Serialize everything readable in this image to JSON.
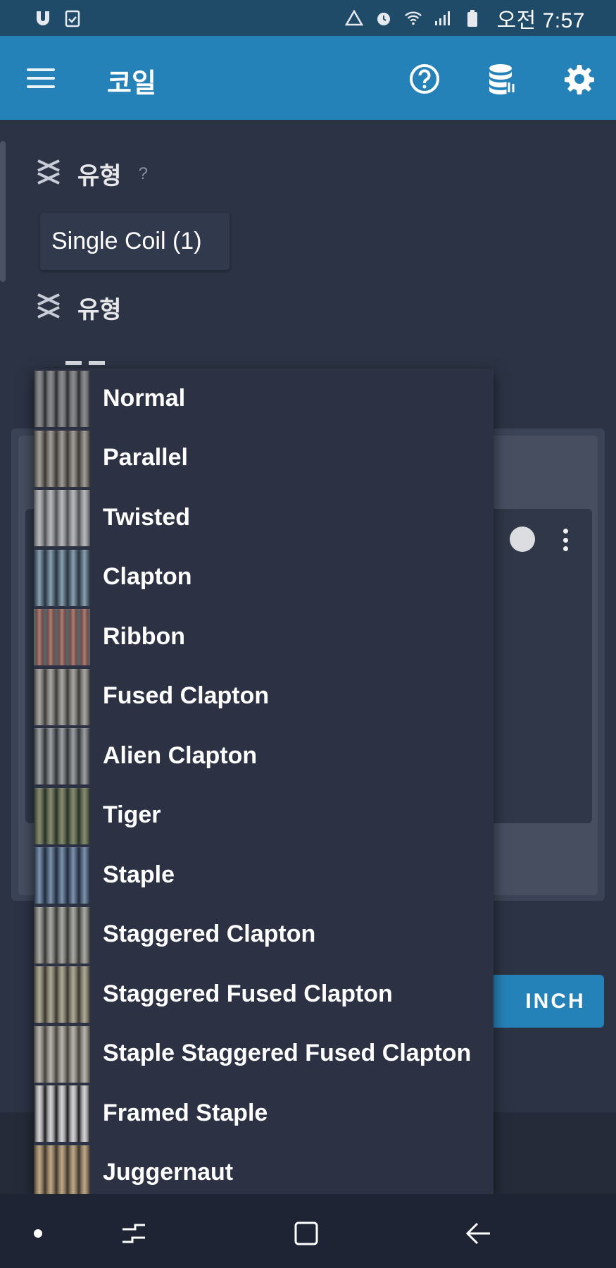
{
  "status_bar": {
    "time": "오전 7:57",
    "left_icons": [
      "app-u-icon",
      "clipboard-check-icon"
    ],
    "right_icons": [
      "sync-triangle-icon",
      "alarm-icon",
      "wifi-icon",
      "signal-icon",
      "battery-icon"
    ]
  },
  "app_bar": {
    "title": "코일",
    "icons": [
      "menu-icon",
      "help-icon",
      "database-icon",
      "gear-icon"
    ],
    "color": "#2582b8"
  },
  "content": {
    "type_label_1": "유형",
    "type_help": "?",
    "selected_chip": "Single Coil (1)",
    "type_label_2": "유형",
    "inch_button": "INCH"
  },
  "dropdown": {
    "items": [
      {
        "label": "Normal",
        "thumb": [
          "#6e7075",
          "#2b2b2d",
          "#8a8b8f"
        ]
      },
      {
        "label": "Parallel",
        "thumb": [
          "#75726e",
          "#3a3633",
          "#a29e98"
        ]
      },
      {
        "label": "Twisted",
        "thumb": [
          "#8e9094",
          "#4c4e52",
          "#b8babf"
        ]
      },
      {
        "label": "Clapton",
        "thumb": [
          "#5a6a78",
          "#263240",
          "#8ba0b2"
        ]
      },
      {
        "label": "Ribbon",
        "thumb": [
          "#7a4a48",
          "#4d6a70",
          "#a58276"
        ]
      },
      {
        "label": "Fused Clapton",
        "thumb": [
          "#7c7b78",
          "#3b3a38",
          "#a9a7a2"
        ]
      },
      {
        "label": "Alien Clapton",
        "thumb": [
          "#6d7073",
          "#2e3134",
          "#9da1a5"
        ]
      },
      {
        "label": "Tiger",
        "thumb": [
          "#5c6a50",
          "#2a2d26",
          "#8a8a70"
        ]
      },
      {
        "label": "Staple",
        "thumb": [
          "#4f6279",
          "#1f2b3b",
          "#7f93ab"
        ]
      },
      {
        "label": "Staggered Clapton",
        "thumb": [
          "#7a7a76",
          "#353533",
          "#aaa9a3"
        ]
      },
      {
        "label": "Staggered Fused Clapton",
        "thumb": [
          "#807c6e",
          "#3a362c",
          "#b0aa98"
        ]
      },
      {
        "label": "Staple Staggered Fused Clapton",
        "thumb": [
          "#8a8780",
          "#44413b",
          "#b9b5ab"
        ]
      },
      {
        "label": "Framed Staple",
        "thumb": [
          "#9a9a9c",
          "#1a1a1c",
          "#d6d6d8"
        ]
      },
      {
        "label": "Juggernaut",
        "thumb": [
          "#8a7a64",
          "#3e3326",
          "#c0a886"
        ]
      }
    ]
  },
  "nav_bar": {
    "icons": [
      "nav-dot-icon",
      "recent-apps-icon",
      "home-icon",
      "back-icon"
    ]
  }
}
